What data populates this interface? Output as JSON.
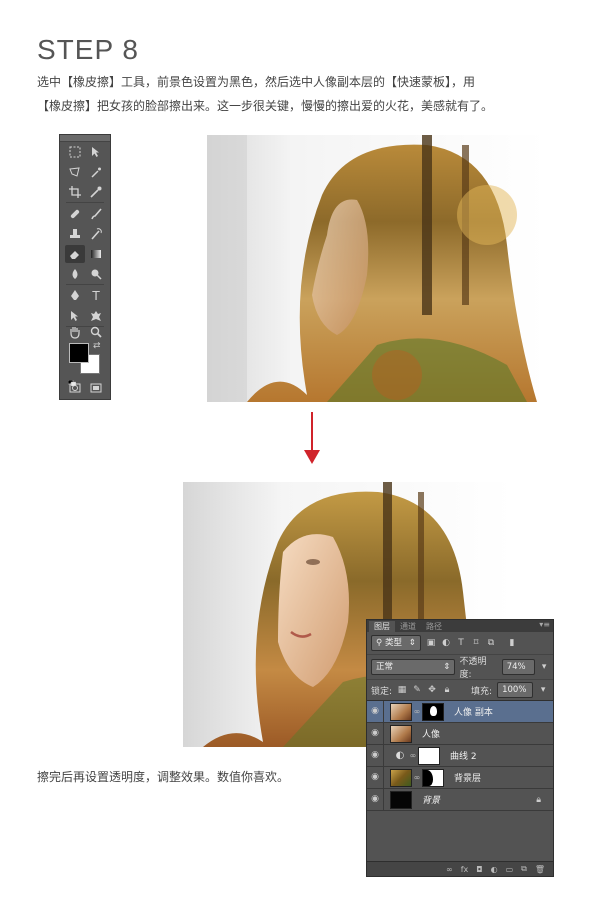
{
  "step": {
    "title": "STEP 8"
  },
  "description": {
    "line1": "选中【橡皮擦】工具，前景色设置为黑色，然后选中人像副本层的【快速蒙板】，用",
    "line2": "【橡皮擦】把女孩的脸部擦出来。这一步很关键，慢慢的擦出爱的火花，美感就有了。"
  },
  "caption": "擦完后再设置透明度，调整效果。数值你喜欢。",
  "colors": {
    "arrow": "#d0232a",
    "panel": "#535353",
    "selected_layer": "#5a6f8f"
  },
  "toolbox": {
    "tools": [
      "marquee-icon",
      "move-icon",
      "lasso-icon",
      "magic-wand-icon",
      "crop-icon",
      "eyedropper-icon",
      "healing-brush-icon",
      "brush-icon",
      "clone-stamp-icon",
      "history-brush-icon",
      "eraser-icon",
      "gradient-icon",
      "blur-icon",
      "dodge-icon",
      "pen-icon",
      "type-icon",
      "path-select-icon",
      "shape-icon",
      "hand-icon",
      "zoom-icon"
    ],
    "type_glyph": "T",
    "active_tool": "eraser-icon"
  },
  "layers_panel": {
    "tabs": [
      "图层",
      "通道",
      "路径"
    ],
    "filter_label": "类型",
    "blend_mode": "正常",
    "opacity_label": "不透明度:",
    "opacity_value": "74%",
    "lock_label": "锁定:",
    "fill_label": "填充:",
    "fill_value": "100%",
    "layers": [
      {
        "name": "人像 副本",
        "selected": true
      },
      {
        "name": "人像",
        "selected": false
      },
      {
        "name": "曲线 2",
        "selected": false
      },
      {
        "name": "背景层",
        "selected": false
      },
      {
        "name": "背景",
        "selected": false,
        "locked": true
      }
    ]
  }
}
